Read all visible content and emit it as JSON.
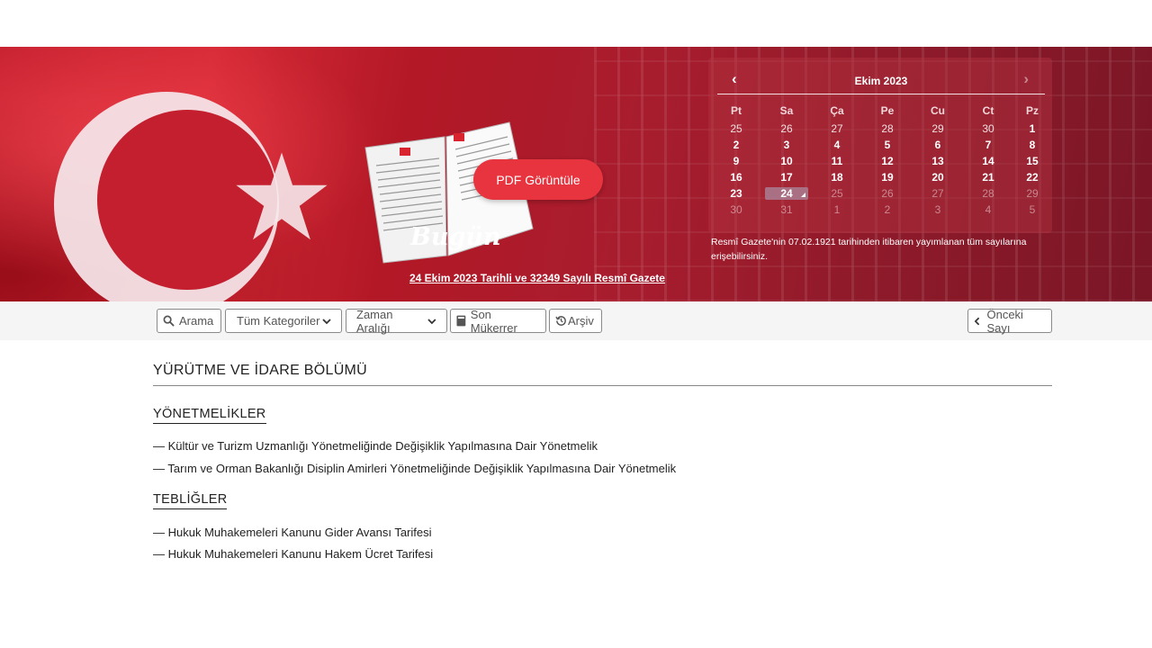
{
  "hero": {
    "pdf_button": "PDF Görüntüle",
    "today_label": "Bugün",
    "issue_link": "24 Ekim 2023 Tarihli ve 32349 Sayılı Resmî Gazete"
  },
  "calendar": {
    "title": "Ekim 2023",
    "prev_icon": "chevron-left-icon",
    "next_icon": "chevron-right-icon",
    "days_of_week": [
      "Pt",
      "Sa",
      "Ça",
      "Pe",
      "Cu",
      "Ct",
      "Pz"
    ],
    "weeks": [
      [
        "25",
        "26",
        "27",
        "28",
        "29",
        "30",
        "1"
      ],
      [
        "2",
        "3",
        "4",
        "5",
        "6",
        "7",
        "8"
      ],
      [
        "9",
        "10",
        "11",
        "12",
        "13",
        "14",
        "15"
      ],
      [
        "16",
        "17",
        "18",
        "19",
        "20",
        "21",
        "22"
      ],
      [
        "23",
        "24",
        "25",
        "26",
        "27",
        "28",
        "29"
      ],
      [
        "30",
        "31",
        "1",
        "2",
        "3",
        "4",
        "5"
      ]
    ],
    "selected_day": "24",
    "note": "Resmî Gazete'nin 07.02.1921 tarihinden itibaren yayımlanan tüm sayılarına erişebilirsiniz."
  },
  "toolbar": {
    "search": "Arama",
    "categories": "Tüm Kategoriler",
    "time_range": "Zaman Aralığı",
    "last_repeat": "Son Mükerrer",
    "archive": "Arşiv",
    "previous_issue": "Önceki Sayı"
  },
  "content": {
    "section_title": "YÜRÜTME VE İDARE BÖLÜMÜ",
    "groups": [
      {
        "title": "YÖNETMELİKLER",
        "items": [
          "— Kültür ve Turizm Uzmanlığı Yönetmeliğinde Değişiklik Yapılmasına Dair Yönetmelik",
          "— Tarım ve Orman Bakanlığı Disiplin Amirleri Yönetmeliğinde Değişiklik Yapılmasına Dair Yönetmelik"
        ]
      },
      {
        "title": "TEBLİĞLER",
        "items": [
          "— Hukuk Muhakemeleri Kanunu Gider Avansı Tarifesi",
          "— Hukuk Muhakemeleri Kanunu Hakem Ücret Tarifesi"
        ]
      }
    ]
  },
  "colors": {
    "hero_red": "#c51f2e",
    "pdf_button": "#e8343f",
    "toolbar_bg": "#f5f5f5"
  }
}
